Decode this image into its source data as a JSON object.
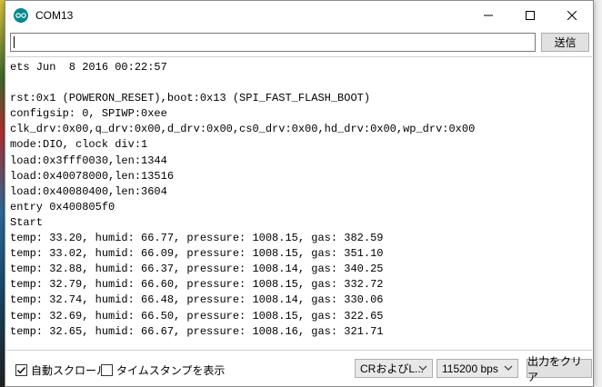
{
  "window": {
    "title": "COM13",
    "accent": "#00878f"
  },
  "send": {
    "input_value": "",
    "button_label": "送信"
  },
  "output": {
    "lines": [
      "ets Jun  8 2016 00:22:57",
      "",
      "rst:0x1 (POWERON_RESET),boot:0x13 (SPI_FAST_FLASH_BOOT)",
      "configsip: 0, SPIWP:0xee",
      "clk_drv:0x00,q_drv:0x00,d_drv:0x00,cs0_drv:0x00,hd_drv:0x00,wp_drv:0x00",
      "mode:DIO, clock div:1",
      "load:0x3fff0030,len:1344",
      "load:0x40078000,len:13516",
      "load:0x40080400,len:3604",
      "entry 0x400805f0",
      "Start",
      "temp: 33.20, humid: 66.77, pressure: 1008.15, gas: 382.59",
      "temp: 33.02, humid: 66.09, pressure: 1008.15, gas: 351.10",
      "temp: 32.88, humid: 66.37, pressure: 1008.14, gas: 340.25",
      "temp: 32.79, humid: 66.60, pressure: 1008.15, gas: 332.72",
      "temp: 32.74, humid: 66.48, pressure: 1008.14, gas: 330.06",
      "temp: 32.69, humid: 66.50, pressure: 1008.15, gas: 322.65",
      "temp: 32.65, humid: 66.67, pressure: 1008.16, gas: 321.71"
    ]
  },
  "status": {
    "autoscroll_label": "自動スクロール",
    "autoscroll_checked": true,
    "timestamp_label": "タイムスタンプを表示",
    "timestamp_checked": false,
    "line_ending": "CRおよびL...",
    "baud": "115200 bps",
    "clear_label": "出力をクリア"
  }
}
